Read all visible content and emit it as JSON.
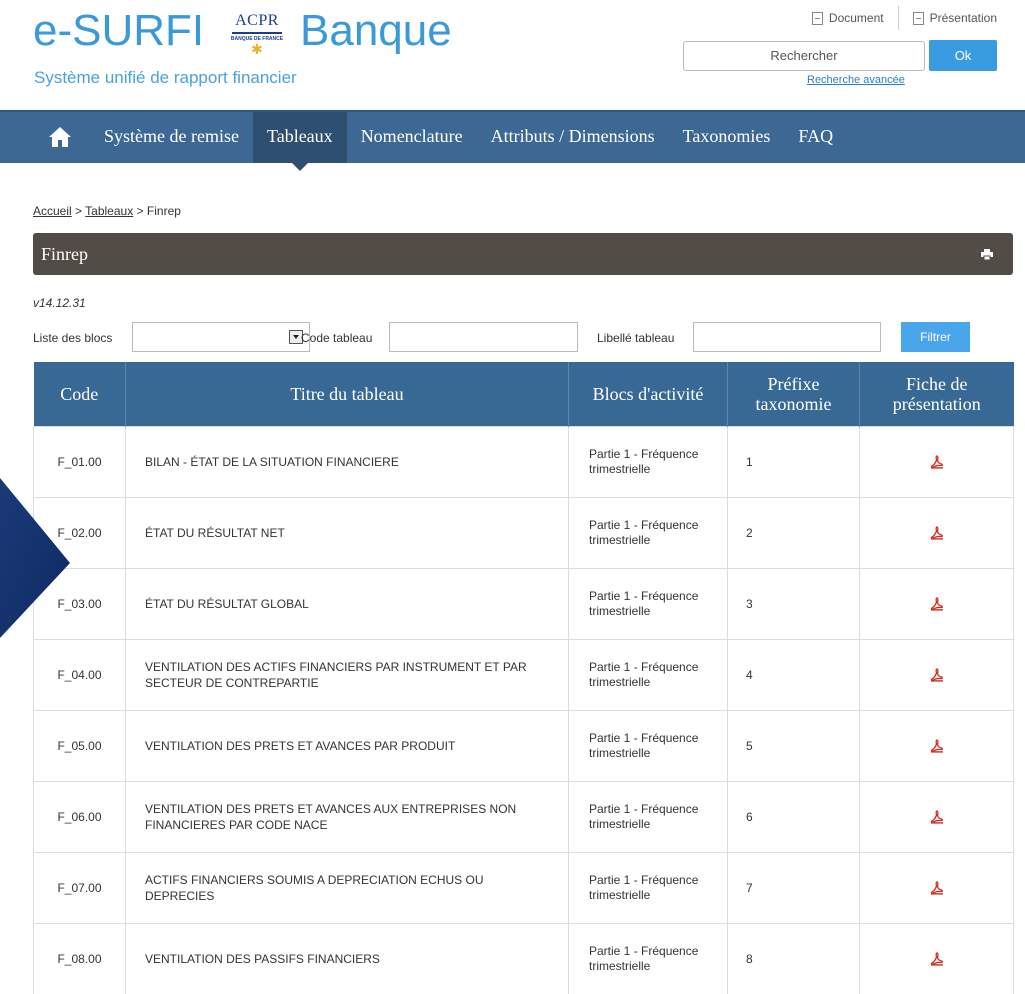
{
  "header": {
    "brand_name": "e-SURFI",
    "brand_suffix": "Banque",
    "logo_text": "ACPR",
    "logo_subtext": "BANQUE DE FRANCE",
    "tagline": "Système unifié de rapport financier",
    "top_links": [
      {
        "label": "Document",
        "icon": "document-icon"
      },
      {
        "label": "Présentation",
        "icon": "document-icon"
      }
    ],
    "search_placeholder": "Rechercher",
    "search_button": "Ok",
    "advanced_search": "Recherche avancée"
  },
  "nav": {
    "home_icon": "home-icon",
    "items": [
      {
        "label": "Système de remise",
        "active": false
      },
      {
        "label": "Tableaux",
        "active": true
      },
      {
        "label": "Nomenclature",
        "active": false
      },
      {
        "label": "Attributs / Dimensions",
        "active": false
      },
      {
        "label": "Taxonomies",
        "active": false
      },
      {
        "label": "FAQ",
        "active": false
      }
    ]
  },
  "breadcrumb": {
    "home": "Accueil",
    "sep": ">",
    "section": "Tableaux",
    "current": "Finrep"
  },
  "section": {
    "title": "Finrep",
    "print_icon": "print-icon",
    "version": "v14.12.31"
  },
  "filters": {
    "blocks_label": "Liste des blocs",
    "code_label": "Code tableau",
    "libelle_label": "Libellé tableau",
    "button": "Filtrer"
  },
  "table": {
    "headers": [
      "Code",
      "Titre du tableau",
      "Blocs d'activité",
      "Préfixe taxonomie",
      "Fiche de présentation"
    ],
    "rows": [
      {
        "code": "F_01.00",
        "title": "BILAN - ÉTAT DE LA SITUATION FINANCIERE",
        "bloc": "Partie 1 - Fréquence trimestrielle",
        "prefix": "1"
      },
      {
        "code": "F_02.00",
        "title": "ÉTAT DU RÉSULTAT NET",
        "bloc": "Partie 1 - Fréquence trimestrielle",
        "prefix": "2"
      },
      {
        "code": "F_03.00",
        "title": "ÉTAT DU RÉSULTAT GLOBAL",
        "bloc": "Partie 1 - Fréquence trimestrielle",
        "prefix": "3"
      },
      {
        "code": "F_04.00",
        "title": "VENTILATION DES ACTIFS FINANCIERS PAR INSTRUMENT ET PAR SECTEUR DE CONTREPARTIE",
        "bloc": "Partie 1 - Fréquence trimestrielle",
        "prefix": "4"
      },
      {
        "code": "F_05.00",
        "title": "VENTILATION DES PRETS ET AVANCES PAR PRODUIT",
        "bloc": "Partie 1 - Fréquence trimestrielle",
        "prefix": "5"
      },
      {
        "code": "F_06.00",
        "title": "VENTILATION DES PRETS ET AVANCES AUX ENTREPRISES NON FINANCIERES PAR CODE NACE",
        "bloc": "Partie 1 - Fréquence trimestrielle",
        "prefix": "6"
      },
      {
        "code": "F_07.00",
        "title": "ACTIFS FINANCIERS SOUMIS A DEPRECIATION ECHUS OU DEPRECIES",
        "bloc": "Partie 1 - Fréquence trimestrielle",
        "prefix": "7"
      },
      {
        "code": "F_08.00",
        "title": "VENTILATION DES PASSIFS FINANCIERS",
        "bloc": "Partie 1 - Fréquence trimestrielle",
        "prefix": "8"
      }
    ]
  },
  "colors": {
    "brand_blue": "#3a9ad9",
    "nav_bg": "#3d6894",
    "nav_active": "#2e4f72",
    "section_bar": "#514c45",
    "table_header": "#386995",
    "button_blue": "#3a9ce0",
    "pdf_red": "#d42a1e"
  }
}
